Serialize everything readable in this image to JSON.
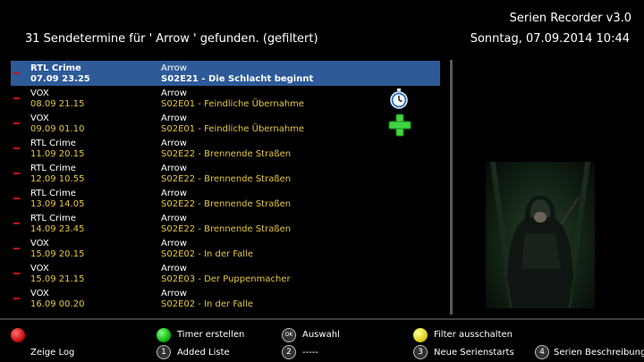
{
  "header": {
    "app_title": "Serien Recorder v3.0",
    "list_title": "31 Sendetermine für ' Arrow ' gefunden. (gefiltert)",
    "datetime": "Sonntag, 07.09.2014  10:44"
  },
  "rows": [
    {
      "sender": "RTL Crime",
      "datetime": "07.09 23.25",
      "series": "Arrow",
      "episode": "S02E21 - Die Schlacht beginnt",
      "selected": true
    },
    {
      "sender": "VOX",
      "datetime": "08.09 21.15",
      "series": "Arrow",
      "episode": "S02E01 - Feindliche Übernahme"
    },
    {
      "sender": "VOX",
      "datetime": "09.09 01.10",
      "series": "Arrow",
      "episode": "S02E01 - Feindliche Übernahme"
    },
    {
      "sender": "RTL Crime",
      "datetime": "11.09 20.15",
      "series": "Arrow",
      "episode": "S02E22 - Brennende Straßen"
    },
    {
      "sender": "RTL Crime",
      "datetime": "12.09 10.55",
      "series": "Arrow",
      "episode": "S02E22 - Brennende Straßen"
    },
    {
      "sender": "RTL Crime",
      "datetime": "13.09 14.05",
      "series": "Arrow",
      "episode": "S02E22 - Brennende Straßen"
    },
    {
      "sender": "RTL Crime",
      "datetime": "14.09 23.45",
      "series": "Arrow",
      "episode": "S02E22 - Brennende Straßen"
    },
    {
      "sender": "VOX",
      "datetime": "15.09 20.15",
      "series": "Arrow",
      "episode": "S02E02 - In der Falle"
    },
    {
      "sender": "VOX",
      "datetime": "15.09 21.15",
      "series": "Arrow",
      "episode": "S02E03 - Der Puppenmacher"
    },
    {
      "sender": "VOX",
      "datetime": "16.09 00.20",
      "series": "Arrow",
      "episode": "S02E02 - In der Falle"
    }
  ],
  "footer": {
    "red_label": "Zeige Log",
    "green_label": "Timer erstellen",
    "ok_key": "OK",
    "ok_label": "Auswahl",
    "yellow_label": "Filter ausschalten",
    "key1": "1",
    "key1_label": "Added Liste",
    "key2": "2",
    "key2_label": "-----",
    "key3": "3",
    "key3_label": "Neue Serienstarts",
    "key4": "4",
    "key4_label": "Serien Beschreibung"
  },
  "colors": {
    "selected_row": "#2e5a98",
    "episode_text": "#e6c547",
    "row_marker": "#cc1111",
    "icon_timer": "timer-icon",
    "icon_add": "add-icon"
  }
}
